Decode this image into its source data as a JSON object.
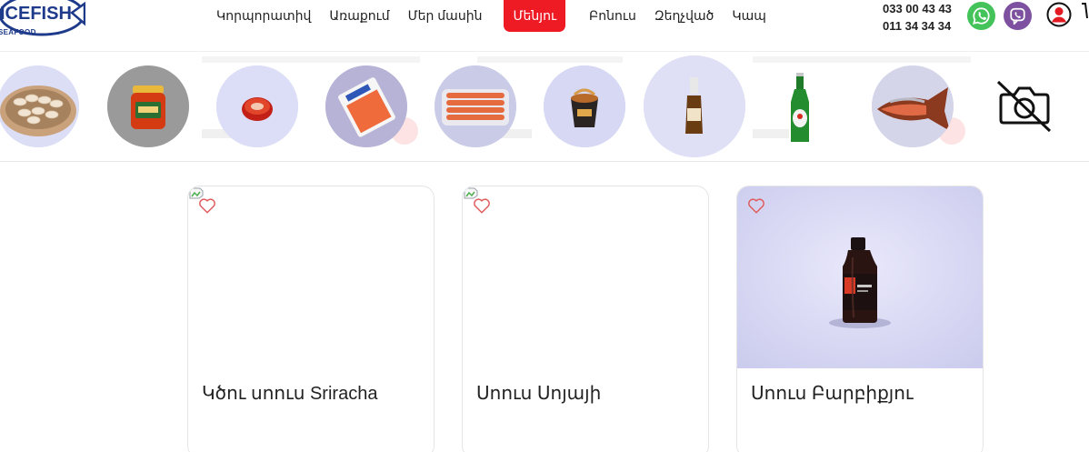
{
  "header": {
    "logo_text": "ICEFISH",
    "logo_sub": "SEAFOOD",
    "nav": [
      {
        "label": "Կորպորատիվ"
      },
      {
        "label": "Առաքում"
      },
      {
        "label": "Մեր մասին"
      },
      {
        "label": "Մենյու"
      },
      {
        "label": "Բոնուս"
      },
      {
        "label": "Զեղչված"
      },
      {
        "label": "Կապ"
      }
    ],
    "phones": [
      "033 00 43 43",
      "011 34 34 34"
    ]
  },
  "colors": {
    "accent": "#ee1b24",
    "whatsapp": "#44c35a",
    "viber": "#7d519f",
    "logo_blue": "#1e3a8a",
    "favorite": "#e05a5a"
  },
  "categories": [
    {
      "icon": "shrimp-plate-icon"
    },
    {
      "icon": "caviar-jar-icon"
    },
    {
      "icon": "caviar-tin-icon"
    },
    {
      "icon": "salmon-pack-icon"
    },
    {
      "icon": "crab-sticks-tray-icon"
    },
    {
      "icon": "noodle-box-icon"
    },
    {
      "icon": "sauce-bottle-icon"
    },
    {
      "icon": "beer-bottle-icon"
    },
    {
      "icon": "smoked-fish-icon"
    },
    {
      "icon": "no-camera-icon"
    }
  ],
  "products": [
    {
      "title": "Կծու սոուս Sriracha",
      "image_loaded": false
    },
    {
      "title": "Սոուս Սոյայի",
      "image_loaded": false
    },
    {
      "title": "Սոուս Բարբիքյու",
      "image_loaded": true
    }
  ]
}
